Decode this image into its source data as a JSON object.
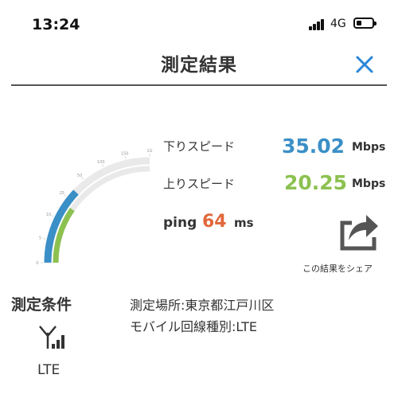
{
  "status_bar": {
    "time": "13:24",
    "network": "4G"
  },
  "header": {
    "title": "測定結果",
    "close_icon": "close-icon"
  },
  "gauge": {
    "scale_labels": [
      "0",
      "5",
      "10",
      "25",
      "50",
      "100",
      "150",
      "1G"
    ],
    "down_mbps": 35.02,
    "up_mbps": 20.25,
    "colors": {
      "down": "#3b8fc7",
      "up": "#8cc150",
      "track": "#e9e9e9"
    }
  },
  "results": {
    "download": {
      "label": "下りスピード",
      "value": "35.02",
      "unit": "Mbps"
    },
    "upload": {
      "label": "上りスピード",
      "value": "20.25",
      "unit": "Mbps"
    },
    "ping": {
      "label": "ping",
      "value": "64",
      "unit": "ms"
    }
  },
  "share": {
    "icon": "share-icon",
    "label": "この結果をシェア"
  },
  "conditions": {
    "title": "測定条件",
    "network_icon": "antenna-signal-icon",
    "network_label": "LTE",
    "location": "測定場所:東京都江戸川区",
    "line_type": "モバイル回線種別:LTE"
  }
}
